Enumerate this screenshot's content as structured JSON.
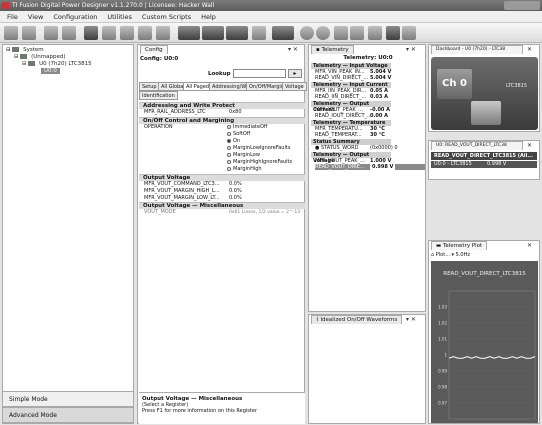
{
  "window": {
    "title": "TI Fusion Digital Power Designer v1.1.270.0 | Licensee: Hacker Wall"
  },
  "menu": [
    "File",
    "View",
    "Configuration",
    "Utilities",
    "Custom Scripts",
    "Help"
  ],
  "tree": {
    "root": "System",
    "group": "(Unmapped)",
    "device": "U0 (7h20) LTC3815",
    "selected": "U0:0"
  },
  "nav": {
    "simple": "Simple Mode",
    "advanced": "Advanced Mode"
  },
  "config": {
    "tab": "Config",
    "subtitle": "Config: U0:0",
    "lookup_label": "Lookup",
    "lookup_btn": "▸",
    "tabs": [
      "Setup",
      "All Global",
      "All Paged",
      "Addressing/WP",
      "On/Off/Margin",
      "Voltage",
      "Identification"
    ],
    "sections": {
      "addr": "Addressing and Write Protect",
      "onoff": "On/Off Control and Margining",
      "outv": "Output Voltage",
      "outv_misc": "Output Voltage — Miscellaneous"
    },
    "addr_rows": [
      {
        "name": "MFR_RAIL_ADDRESS_LTC",
        "val": "0x80"
      }
    ],
    "operation_label": "OPERATION",
    "operation_opts": [
      "ImmediateOff",
      "SoftOff",
      "On",
      "MarginLowIgnoreFaults",
      "MarginLow",
      "MarginHighIgnoreFaults",
      "MarginHigh"
    ],
    "outv_rows": [
      {
        "name": "MFR_VOUT_COMMAND_LTC3...",
        "val": "0.0%"
      },
      {
        "name": "MFR_VOUT_MARGIN_HIGH_L...",
        "val": "0.0%"
      },
      {
        "name": "MFR_VOUT_MARGIN_LOW_LT...",
        "val": "0.0%"
      }
    ],
    "misc_row": {
      "name": "VOUT_MODE",
      "val": "0x01 Linear, 1/2 value = 2^-13"
    },
    "help": {
      "title": "Output Voltage — Miscellaneous",
      "line1": "(Select a Register)",
      "line2": "Press F1 for more information on this Register"
    }
  },
  "telemetry": {
    "tab": "Telemetry",
    "title": "Telemetry: U0:0",
    "groups": [
      {
        "header": "Telemetry — Input Voltage",
        "rows": [
          {
            "name": "MFR_VIN_PEAK_IN...",
            "val": "5.004 V"
          },
          {
            "name": "READ_VIN_DIRECT_...",
            "val": "5.004 V"
          }
        ]
      },
      {
        "header": "Telemetry — Input Current",
        "rows": [
          {
            "name": "MFR_IIN_PEAK_DIR...",
            "val": "0.05 A"
          },
          {
            "name": "READ_IIN_DIRECT_...",
            "val": "0.03 A"
          }
        ]
      },
      {
        "header": "Telemetry — Output Current",
        "rows": [
          {
            "name": "MFR_IOUT_PEAK_...",
            "val": "-0.00 A"
          },
          {
            "name": "READ_IOUT_DIRECT_...",
            "val": "0.00 A"
          }
        ]
      },
      {
        "header": "Telemetry — Temperature",
        "rows": [
          {
            "name": "MFR_TEMPERATU...",
            "val": "30 °C"
          },
          {
            "name": "READ_TEMPERAT...",
            "val": "30 °C"
          }
        ]
      },
      {
        "header": "Status Summary",
        "rows": [
          {
            "name": "STATUS_WORD",
            "val": "(0x0000) 0"
          }
        ]
      },
      {
        "header": "Telemetry — Output Voltage",
        "rows": [
          {
            "name": "MFR_VOUT_PEAK_...",
            "val": "1.000 V"
          },
          {
            "name": "READ_VOUT_DIRE...",
            "val": "0.998 V"
          }
        ]
      }
    ]
  },
  "waveform": {
    "tab": "Idealized On/Off Waveforms"
  },
  "dashboard": {
    "tab": "Dashboard - U0 (7h20) - LTC38",
    "channel": "Ch 0",
    "label": "LTC3815"
  },
  "vout": {
    "tab": "U0: READ_VOUT_DIRECT_LTC38",
    "header": "READ_VOUT_DIRECT_LTC3815 (All...",
    "row_name": "U0:0 - LTC3815",
    "row_val": "0.998 V"
  },
  "plot": {
    "tab": "Telemetry Plot",
    "toolbar": "Plot...  ▾ 5.0Hz",
    "chart_data": {
      "type": "line",
      "title": "READ_VOUT_DIRECT_LTC3815",
      "ylim": [
        0.96,
        1.04
      ],
      "yticks": [
        "1.03",
        "1.02",
        "1.01",
        "1",
        "0.99",
        "0.98",
        "0.97"
      ],
      "series": [
        {
          "values": [
            0.998,
            0.999,
            0.998,
            0.998,
            0.999,
            0.998,
            0.999,
            0.998,
            0.998,
            0.999,
            0.998,
            0.999,
            0.998,
            0.998,
            0.999,
            0.998,
            0.999,
            0.998,
            0.998,
            0.999
          ]
        }
      ]
    }
  }
}
